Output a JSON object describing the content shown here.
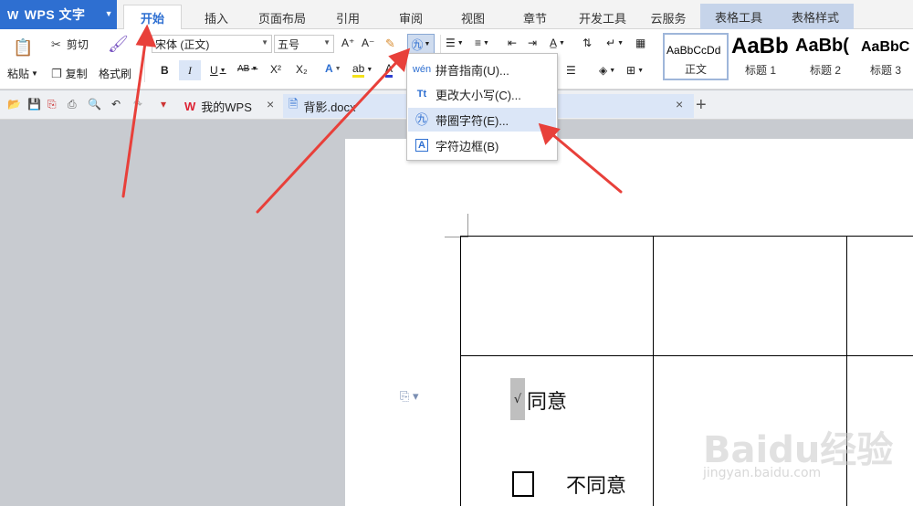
{
  "app": {
    "title": "WPS 文字"
  },
  "tabs": [
    {
      "label": "开始"
    },
    {
      "label": "插入"
    },
    {
      "label": "页面布局"
    },
    {
      "label": "引用"
    },
    {
      "label": "审阅"
    },
    {
      "label": "视图"
    },
    {
      "label": "章节"
    },
    {
      "label": "开发工具"
    },
    {
      "label": "云服务"
    },
    {
      "label": "表格工具"
    },
    {
      "label": "表格样式"
    }
  ],
  "ribbon": {
    "paste": "粘贴",
    "cut": "剪切",
    "copy": "复制",
    "format_painter": "格式刷",
    "font_name": "宋体 (正文)",
    "font_size": "五号",
    "bold": "B",
    "italic": "I",
    "underline": "U",
    "strike": "AB",
    "superscript": "X²",
    "subscript": "X₂",
    "grow_font": "A⁺",
    "shrink_font": "A⁻"
  },
  "styles": [
    {
      "preview": "AaBbCcDd",
      "name": "正文"
    },
    {
      "preview": "AaBb",
      "name": "标题 1"
    },
    {
      "preview": "AaBb(",
      "name": "标题 2"
    },
    {
      "preview": "AaBbC",
      "name": "标题 3"
    }
  ],
  "doc_tabs": [
    {
      "label": "我的WPS"
    },
    {
      "label": "背影.docx"
    }
  ],
  "menu": {
    "items": [
      {
        "label": "拼音指南(U)..."
      },
      {
        "label": "更改大小写(C)..."
      },
      {
        "label": "带圈字符(E)..."
      },
      {
        "label": "字符边框(B)"
      }
    ]
  },
  "document": {
    "agree": "同意",
    "disagree": "不同意",
    "check": "√"
  },
  "watermark": {
    "logo": "Baidu经验",
    "url": "jingyan.baidu.com"
  },
  "colors": {
    "accent": "#2e6fd1",
    "arrow": "#e8403a",
    "context_tab": "#c6d4ea"
  }
}
